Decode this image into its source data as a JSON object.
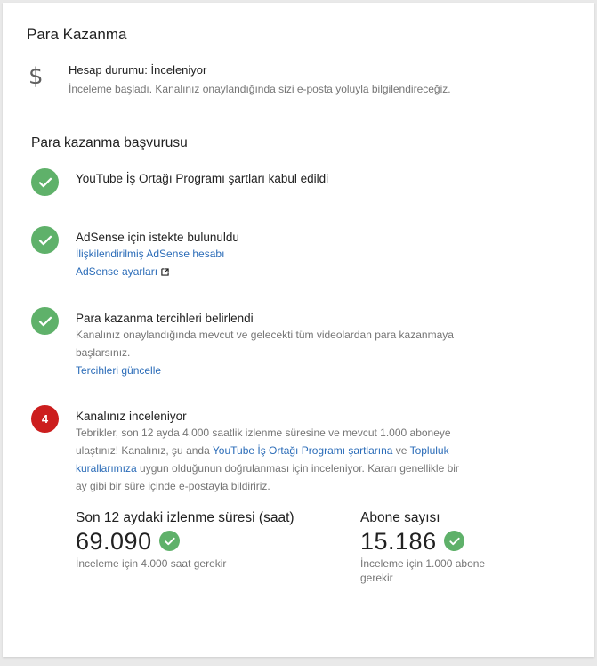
{
  "header": {
    "title": "Para Kazanma"
  },
  "status": {
    "icon": "dollar-icon",
    "glyph": "$",
    "title": "Hesap durumu: İnceleniyor",
    "description": "İnceleme başladı. Kanalınız onaylandığında sizi e-posta yoluyla bilgilendireceğiz."
  },
  "application": {
    "title": "Para kazanma başvurusu",
    "steps": [
      {
        "title": "YouTube İş Ortağı Programı şartları kabul edildi"
      },
      {
        "title": "AdSense için istekte bulunuldu",
        "link1": "İlişkilendirilmiş AdSense hesabı",
        "link2": "AdSense ayarları"
      },
      {
        "title": "Para kazanma tercihleri belirlendi",
        "text_line1": "Kanalınız onaylandığında mevcut ve gelecekti tüm videolardan para kazanmaya",
        "text_line2": "başlarsınız.",
        "link": "Tercihleri güncelle"
      },
      {
        "number": "4",
        "title": "Kanalınız inceleniyor",
        "text_line1": "Tebrikler, son 12 ayda 4.000 saatlik izlenme süresine ve mevcut 1.000 aboneye",
        "text_line2_a": "ulaştınız! Kanalınız, şu anda ",
        "text_line2_link1": "YouTube İş Ortağı Programı şartlarına",
        "text_line2_b": " ve ",
        "text_line2_link2": "Topluluk",
        "text_line3_link": "kurallarımıza",
        "text_line3_b": " uygun olduğunun doğrulanması için inceleniyor. Kararı genellikle bir",
        "text_line4": "ay gibi bir süre içinde e-postayla bildiririz."
      }
    ]
  },
  "metrics": {
    "watch_hours": {
      "label": "Son 12 aydaki izlenme süresi (saat)",
      "value": "69.090",
      "note": "İnceleme için 4.000 saat gerekir"
    },
    "subscribers": {
      "label": "Abone sayısı",
      "value": "15.186",
      "note_line1": "İnceleme için 1.000 abone",
      "note_line2": "gerekir"
    }
  },
  "colors": {
    "success": "#5fb16a",
    "current": "#cc1e1e",
    "link": "#2b6cb8"
  }
}
